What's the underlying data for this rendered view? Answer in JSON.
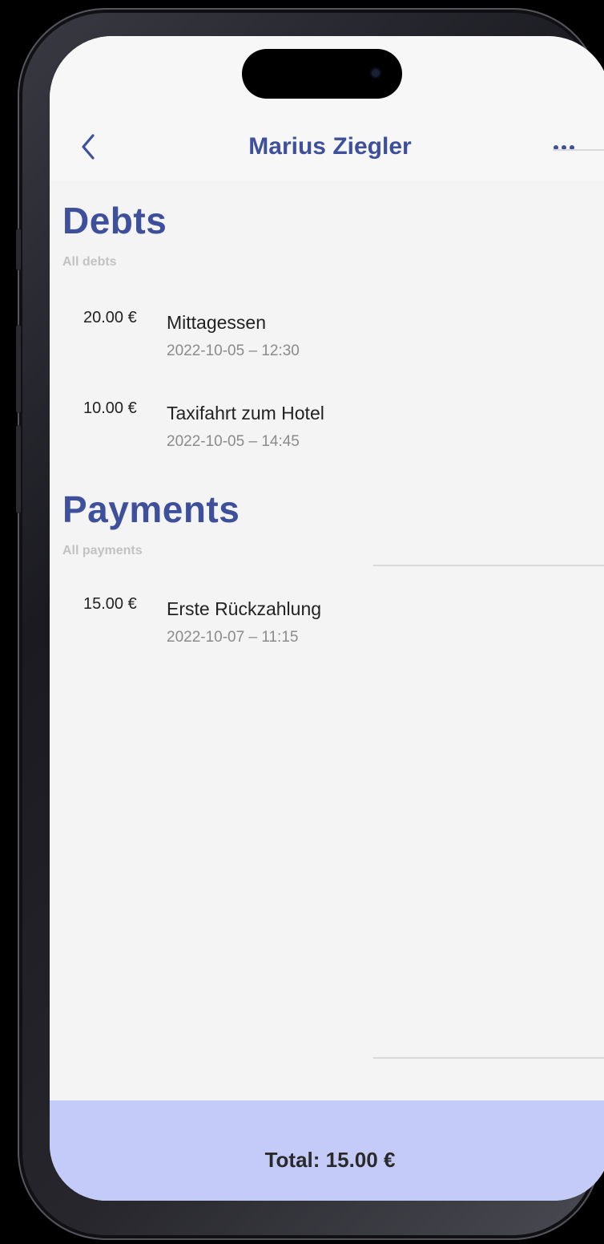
{
  "header": {
    "title": "Marius Ziegler",
    "back_icon": "chevron-left-icon",
    "more_icon": "ellipsis-icon"
  },
  "debts": {
    "title": "Debts",
    "subtitle": "All debts",
    "items": [
      {
        "amount": "20.00 €",
        "description": "Mittagessen",
        "date": "2022-10-05 – 12:30"
      },
      {
        "amount": "10.00 €",
        "description": "Taxifahrt zum Hotel",
        "date": "2022-10-05 – 14:45"
      }
    ]
  },
  "payments": {
    "title": "Payments",
    "subtitle": "All payments",
    "items": [
      {
        "amount": "15.00 €",
        "description": "Erste Rückzahlung",
        "date": "2022-10-07 – 11:15"
      }
    ]
  },
  "footer": {
    "total": "Total: 15.00 €"
  },
  "colors": {
    "accent": "#3e4f9c",
    "footer_bg": "#c4cbf8",
    "screen_bg": "#f4f4f4"
  }
}
